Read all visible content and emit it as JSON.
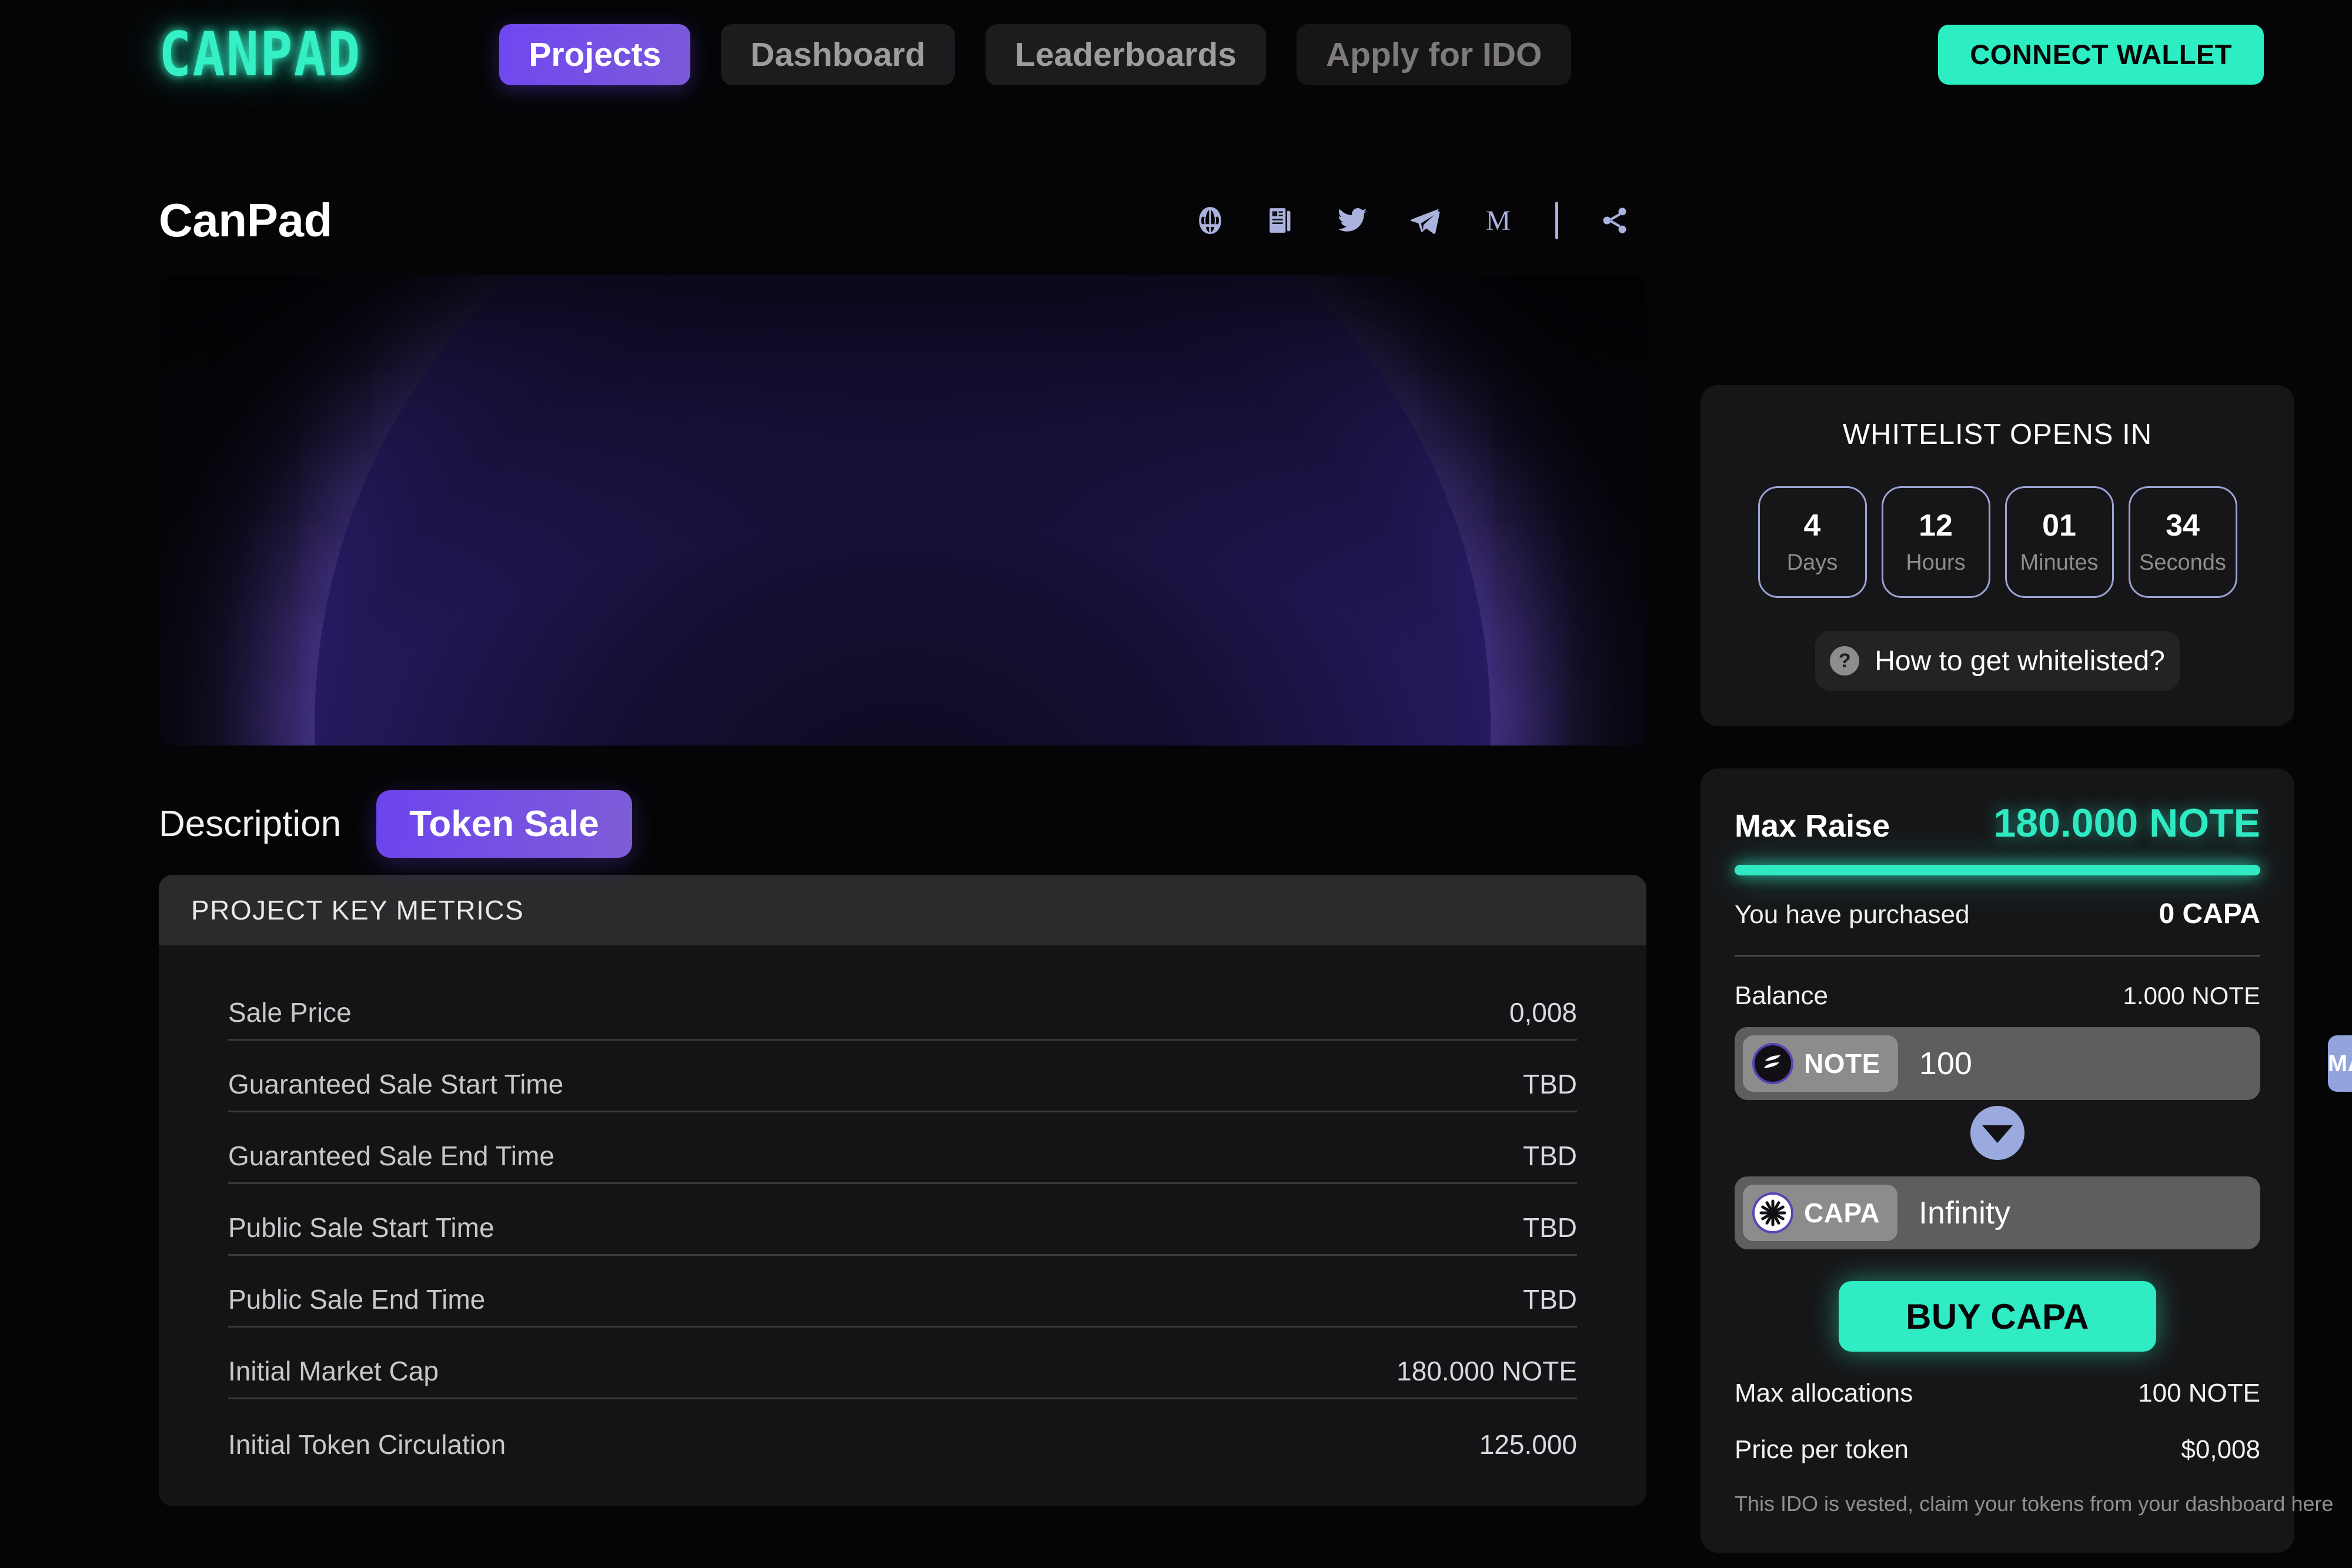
{
  "header": {
    "logo": "CANPAD",
    "nav": [
      {
        "label": "Projects",
        "state": "active"
      },
      {
        "label": "Dashboard",
        "state": "normal"
      },
      {
        "label": "Leaderboards",
        "state": "normal"
      },
      {
        "label": "Apply for IDO",
        "state": "dim"
      }
    ],
    "wallet_button": "CONNECT WALLET",
    "accent_teal": "#2dedc3",
    "accent_purple": "#7047f0"
  },
  "project": {
    "title": "CanPad",
    "socials": [
      {
        "icon": "globe-icon",
        "name": "website"
      },
      {
        "icon": "whitepaper-icon",
        "name": "whitepaper"
      },
      {
        "icon": "twitter-icon",
        "name": "twitter"
      },
      {
        "icon": "telegram-icon",
        "name": "telegram"
      },
      {
        "icon": "medium-icon",
        "name": "medium"
      },
      {
        "icon": "divider",
        "name": "divider"
      },
      {
        "icon": "share-icon",
        "name": "share"
      }
    ]
  },
  "tabs": [
    {
      "label": "Description",
      "active": false
    },
    {
      "label": "Token Sale",
      "active": true
    }
  ],
  "metrics": {
    "header": "PROJECT KEY METRICS",
    "rows": [
      {
        "label": "Sale Price",
        "value": "0,008"
      },
      {
        "label": "Guaranteed Sale Start Time",
        "value": "TBD"
      },
      {
        "label": "Guaranteed Sale End Time",
        "value": "TBD"
      },
      {
        "label": "Public Sale Start Time",
        "value": "TBD"
      },
      {
        "label": "Public Sale End Time",
        "value": "TBD"
      },
      {
        "label": "Initial Market Cap",
        "value": "180.000 NOTE"
      },
      {
        "label": "Initial Token Circulation",
        "value": "125.000"
      }
    ]
  },
  "whitelist": {
    "title": "WHITELIST OPENS IN",
    "countdown": [
      {
        "value": "4",
        "unit": "Days"
      },
      {
        "value": "12",
        "unit": "Hours"
      },
      {
        "value": "01",
        "unit": "Minutes"
      },
      {
        "value": "34",
        "unit": "Seconds"
      }
    ],
    "help_label": "How to get whitelisted?",
    "help_icon": "question-mark-icon"
  },
  "buy": {
    "max_raise_label": "Max Raise",
    "max_raise_value": "180.000 NOTE",
    "progress_percent": 100,
    "purchased_label": "You have purchased",
    "purchased_value": "0 CAPA",
    "balance_label": "Balance",
    "balance_value": "1.000 NOTE",
    "from_token": "NOTE",
    "from_amount": "100",
    "max_button": "MAX",
    "to_token": "CAPA",
    "to_amount": "Infinity",
    "buy_button": "BUY CAPA",
    "max_alloc_label": "Max allocations",
    "max_alloc_value": "100 NOTE",
    "price_label": "Price per token",
    "price_value": "$0,008",
    "vested_note": "This IDO is vested, claim your tokens from your dashboard here"
  }
}
